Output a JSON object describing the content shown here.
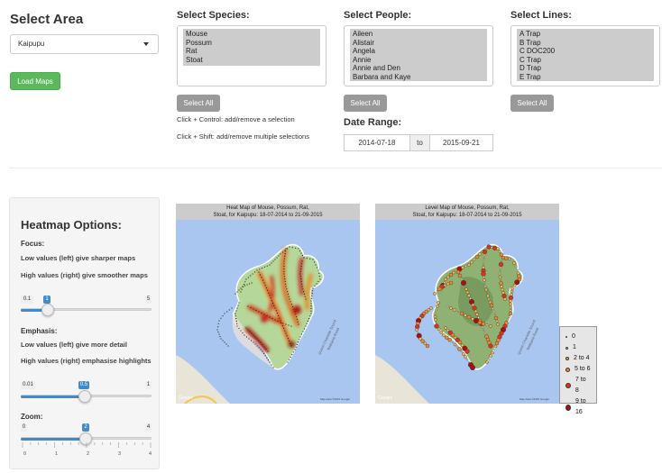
{
  "area": {
    "heading": "Select Area",
    "selected": "Kaipupu",
    "load_button": "Load Maps"
  },
  "species": {
    "heading": "Select Species:",
    "options": [
      "Mouse",
      "Possum",
      "Rat",
      "Stoat"
    ],
    "select_all": "Select All",
    "hint_control": "Click + Control: add/remove a selection",
    "hint_shift": "Click + Shift: add/remove multiple selections"
  },
  "people": {
    "heading": "Select People:",
    "options": [
      "Aileen",
      "Alistair",
      "Angela",
      "Annie",
      "Annie and Den",
      "Barbara and Kaye"
    ],
    "select_all": "Select All"
  },
  "lines": {
    "heading": "Select Lines:",
    "options": [
      "A Trap",
      "B Trap",
      "C DOC200",
      "C Trap",
      "D Trap",
      "E Trap"
    ],
    "select_all": "Select All"
  },
  "date_range": {
    "heading": "Date Range:",
    "start": "2014-07-18",
    "separator": "to",
    "end": "2015-09-21"
  },
  "heatmap_options": {
    "heading": "Heatmap Options:",
    "focus": {
      "label": "Focus:",
      "desc_low": "Low values (left) give sharper maps",
      "desc_high": "High values (right) give smoother maps",
      "min": "0.1",
      "max": "5",
      "value": "1",
      "value_fraction": 0.18
    },
    "emphasis": {
      "label": "Emphasis:",
      "desc_low": "Low values (left) give more detail",
      "desc_high": "High values (right) emphasise highlights",
      "min": "0.01",
      "max": "1",
      "value": "0.5",
      "value_fraction": 0.5
    },
    "zoom": {
      "label": "Zoom:",
      "min": "0",
      "max": "4",
      "value": "2",
      "value_fraction": 0.5,
      "ticks": [
        "0",
        "1",
        "2",
        "3",
        "4"
      ]
    }
  },
  "maps": {
    "heat_title_1": "Heat Map of Mouse, Possum, Rat,",
    "heat_title_2": "Stoat, for Kaipupu: 18-07-2014 to 21-09-2015",
    "level_title_1": "Level Map of Mouse, Possum, Rat,",
    "level_title_2": "Stoat, for Kaipupu: 18-07-2014 to 21-09-2015",
    "map_brand": "Google",
    "map_credit": "Map data ©2015 Google",
    "road_label": "Waikawa Road",
    "coast_label": "Queen Charlotte Sound",
    "legend": [
      "0",
      "1",
      "2 to 4",
      "5 to 6",
      "7 to 8",
      "9 to 16"
    ]
  },
  "colors": {
    "green_button": "#5cb85c",
    "slider_blue": "#428bca",
    "water": "#a5c4f2",
    "land": "#b5d89a",
    "legend_fills": [
      "#ffffff",
      "#ffe6a8",
      "#f9b84a",
      "#ef8a2c",
      "#d6341f",
      "#a31111"
    ]
  }
}
